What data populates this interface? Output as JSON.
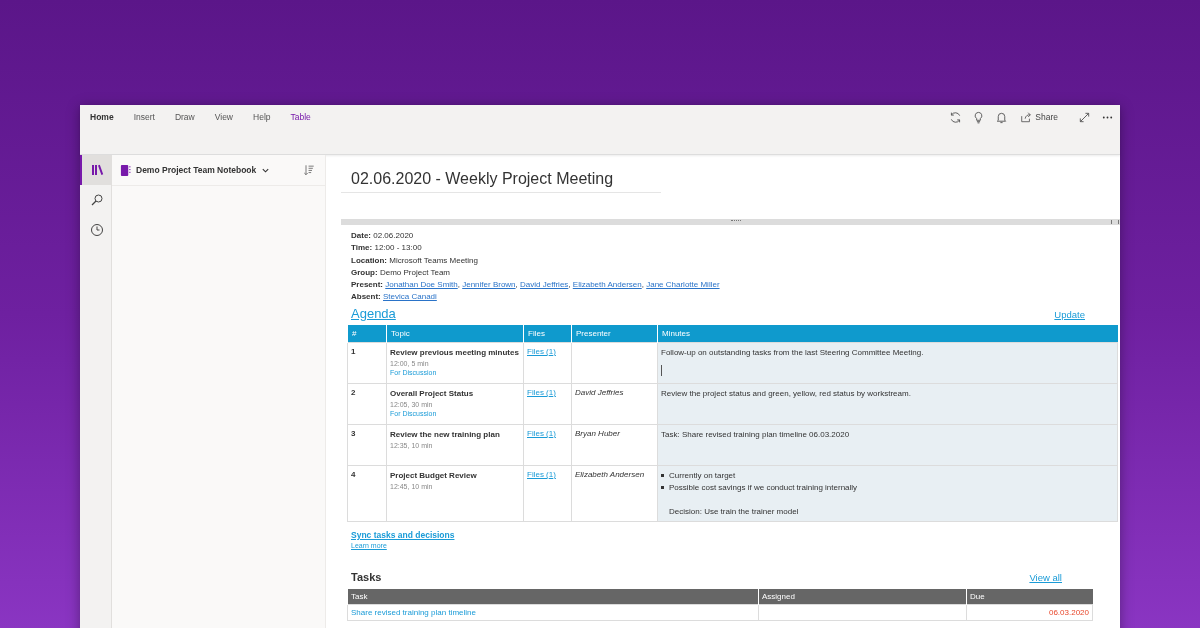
{
  "ribbon": {
    "tabs": [
      {
        "label": "Home",
        "selected": true,
        "contextual": false
      },
      {
        "label": "Insert",
        "selected": false,
        "contextual": false
      },
      {
        "label": "Draw",
        "selected": false,
        "contextual": false
      },
      {
        "label": "View",
        "selected": false,
        "contextual": false
      },
      {
        "label": "Help",
        "selected": false,
        "contextual": false
      },
      {
        "label": "Table",
        "selected": false,
        "contextual": true
      }
    ],
    "share_label": "Share"
  },
  "rail": [
    {
      "kind": "notebooks",
      "selected": true
    },
    {
      "kind": "search",
      "selected": false
    },
    {
      "kind": "recent",
      "selected": false
    }
  ],
  "notebook": {
    "name": "Demo Project Team Notebook"
  },
  "page": {
    "title": "02.06.2020 - Weekly Project Meeting",
    "info": [
      {
        "label": "Date:",
        "value": "02.06.2020"
      },
      {
        "label": "Time:",
        "value": "12:00 - 13:00"
      },
      {
        "label": "Location:",
        "value": "Microsoft Teams Meeting"
      },
      {
        "label": "Group:",
        "value": "Demo Project Team"
      },
      {
        "label": "Present:",
        "separator": ",",
        "links": [
          "Jonathan Doe Smith",
          "Jennifer Brown",
          "David Jeffries",
          "Elizabeth Andersen",
          "Jane Charlotte Miller"
        ]
      },
      {
        "label": "Absent:",
        "links": [
          "Stevica Canadi"
        ]
      }
    ],
    "agenda": {
      "heading": "Agenda",
      "update": "Update",
      "columns": [
        "#",
        "Topic",
        "Files",
        "Presenter",
        "Minutes"
      ],
      "rows": [
        {
          "number": "1",
          "topic": "Review previous meeting minutes",
          "time": "12:00, 5 min",
          "category": "For Discussion",
          "files": "Files (1)",
          "presenter": "",
          "cursor": true,
          "minutes": [
            {
              "kind": "text",
              "text": "Follow-up on outstanding tasks from the last Steering Committee Meeting."
            }
          ]
        },
        {
          "number": "2",
          "topic": "Overall Project Status",
          "time": "12:05, 30 min",
          "category": "For Discussion",
          "files": "Files (1)",
          "presenter": "David Jeffries",
          "cursor": false,
          "minutes": [
            {
              "kind": "text",
              "text": "Review the project status and green, yellow, red status by workstream."
            }
          ]
        },
        {
          "number": "3",
          "topic": "Review the new training plan",
          "time": "12:35, 10 min",
          "files": "Files (1)",
          "presenter": "Bryan Huber",
          "cursor": false,
          "minutes": [
            {
              "kind": "text",
              "text": "Task: Share revised training plan timeline 06.03.2020"
            }
          ]
        },
        {
          "number": "4",
          "topic": "Project Budget Review",
          "time": "12:45, 10 min",
          "files": "Files (1)",
          "presenter": "Elizabeth Andersen",
          "cursor": false,
          "minutes": [
            {
              "kind": "bullet",
              "text": "Currently on target"
            },
            {
              "kind": "bullet",
              "text": "Possible cost savings if we conduct training internally"
            },
            {
              "kind": "gap"
            },
            {
              "kind": "text",
              "text": "Decision: Use train the trainer model"
            }
          ]
        }
      ]
    },
    "sync": {
      "link": "Sync tasks and decisions",
      "learn_more": "Learn more"
    },
    "tasks": {
      "heading": "Tasks",
      "view_all": "View all",
      "columns": [
        "Task",
        "Assigned",
        "Due"
      ],
      "rows": [
        {
          "task": "Share revised training plan timeline",
          "assigned": "",
          "due": "06.03.2020",
          "overdue": true
        }
      ]
    }
  }
}
